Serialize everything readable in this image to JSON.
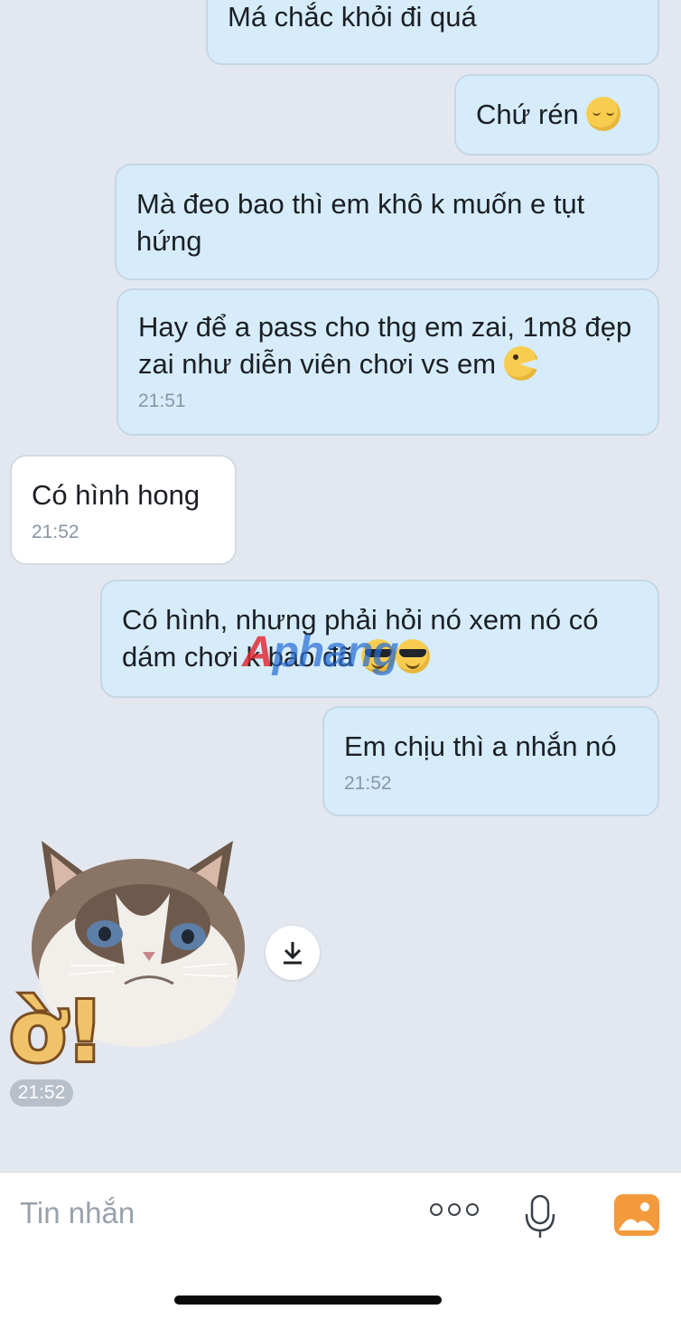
{
  "messages": [
    {
      "dir": "out",
      "text": "Má chắc khỏi đi quá"
    },
    {
      "dir": "out",
      "text": "Chứ rén",
      "emoji": "sleepy-face"
    },
    {
      "dir": "out",
      "text": "Mà đeo bao thì em khô k muốn e tụt hứng"
    },
    {
      "dir": "out",
      "text": "Hay để a pass cho thg em zai, 1m8 đẹp zai như diễn viên chơi vs em",
      "emoji": "winking-face",
      "time": "21:51"
    },
    {
      "dir": "in",
      "text": "Có hình hong",
      "time": "21:52"
    },
    {
      "dir": "out",
      "text": "Có hình, nhưng phải hỏi nó xem nó có dám chơi k bao đã",
      "emoji": "sunglasses-face"
    },
    {
      "dir": "out",
      "text": "Em chịu thì a nhắn nó",
      "time": "21:52"
    }
  ],
  "sticker": {
    "caption": "ờ!",
    "time": "21:52",
    "icon": "grumpy-cat-sticker"
  },
  "watermark": {
    "text_a": "A",
    "text_rest": "phang"
  },
  "composer": {
    "placeholder": "Tin nhắn",
    "icons": [
      "more-options-icon",
      "microphone-icon",
      "photo-gallery-icon"
    ]
  },
  "colors": {
    "background": "#e3e8f0",
    "outgoing_bubble": "#d6ecfb",
    "incoming_bubble": "#ffffff",
    "photo_icon": "#f39a3d"
  }
}
